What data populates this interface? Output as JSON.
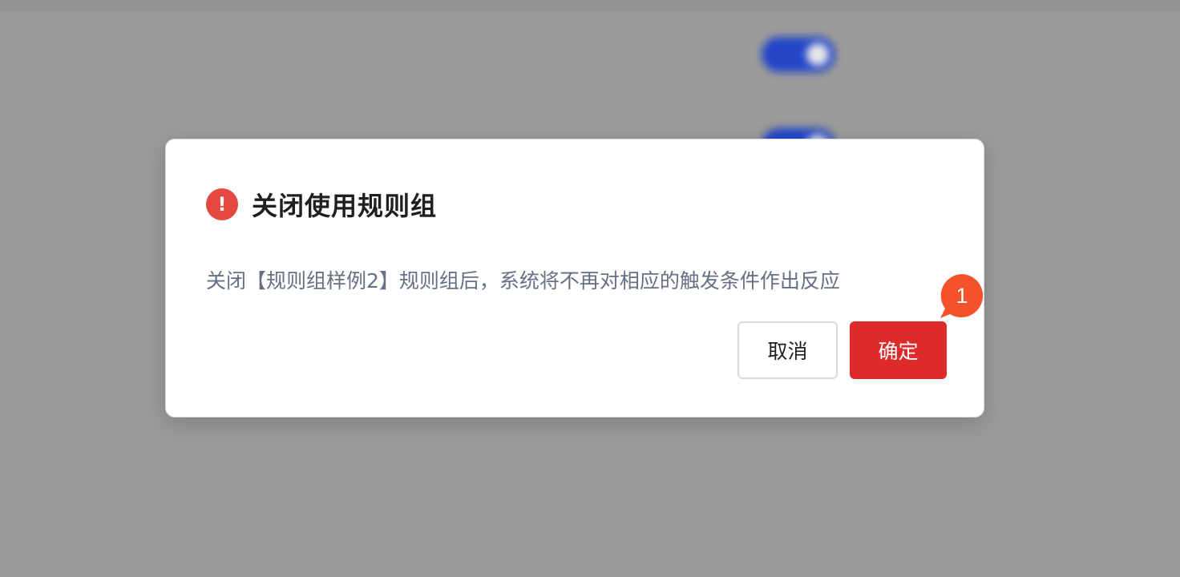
{
  "colors": {
    "backdrop": "#9b9b9b",
    "toggle_on": "#2346c9",
    "danger": "#e5483f",
    "confirm": "#dd2b2b",
    "badge": "#f3522b"
  },
  "background": {
    "toggles": [
      {
        "state": "on"
      },
      {
        "state": "on"
      }
    ]
  },
  "dialog": {
    "icon": "exclamation-icon",
    "icon_glyph": "!",
    "title": "关闭使用规则组",
    "message": "关闭【规则组样例2】规则组后，系统将不再对相应的触发条件作出反应",
    "cancel_label": "取消",
    "confirm_label": "确定"
  },
  "annotation": {
    "step_number": "1"
  }
}
